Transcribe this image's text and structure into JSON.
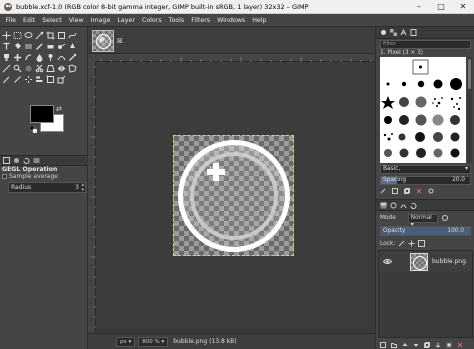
{
  "window": {
    "title": "bubble.xcf-1.0 (RGB color 8-bit gamma integer, GIMP built-in sRGB, 1 layer) 32x32 – GIMP",
    "minimize": "–",
    "maximize": "□",
    "close": "✕"
  },
  "menu": [
    "File",
    "Edit",
    "Select",
    "View",
    "Image",
    "Layer",
    "Colors",
    "Tools",
    "Filters",
    "Windows",
    "Help"
  ],
  "tool_options": {
    "heading": "GEGL Operation",
    "sample_label": "Sample average",
    "radius_label": "Radius",
    "radius_value": "3"
  },
  "image_tab": {
    "close_glyph": "⊠"
  },
  "status": {
    "unit": "px ▾",
    "zoom": "800 % ▾",
    "file": "bubble.png (13.8 kB)"
  },
  "brushes": {
    "filter_placeholder": "filter",
    "current_brush": "1. Pixel (3 × 3)",
    "tag_value": "Basic,",
    "spacing_label": "Spacing",
    "spacing_value": "20.0"
  },
  "layers": {
    "mode_label": "Mode",
    "mode_value": "Normal ▾",
    "opacity_label": "Opacity",
    "opacity_value": "100.0",
    "opacity_fraction": 1.0,
    "lock_label": "Lock:",
    "items": [
      {
        "name": "bubble.png",
        "visible": true
      }
    ]
  },
  "colors": {
    "foreground": "#000000",
    "background": "#ffffff",
    "selection_border": "#d8d860",
    "spacing_fill": "#5a6f8c"
  }
}
